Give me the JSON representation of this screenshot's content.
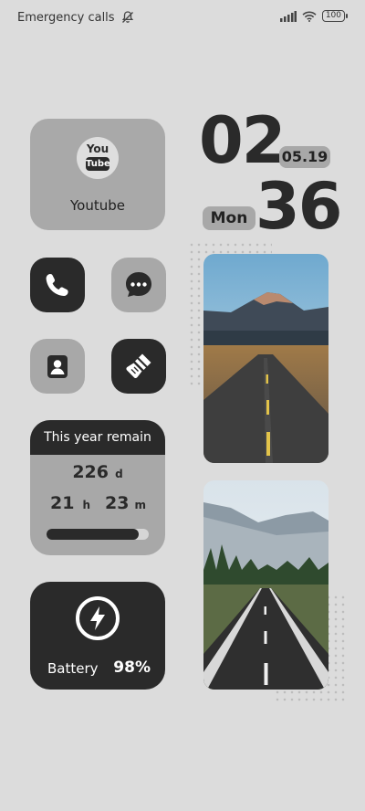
{
  "status": {
    "left_text": "Emergency calls",
    "battery": "100"
  },
  "youtube": {
    "icon_text_top": "You",
    "icon_text_bottom": "Tube",
    "label": "Youtube"
  },
  "clock": {
    "hour": "02",
    "minute": "36",
    "date": "05.19",
    "day": "Mon"
  },
  "year_remain": {
    "title": "This year remain",
    "days": "226",
    "days_unit": "d",
    "hours": "21",
    "hours_unit": "h",
    "minutes": "23",
    "minutes_unit": "m",
    "progress": 0.9
  },
  "battery_widget": {
    "label": "Battery",
    "percent": "98%"
  },
  "icons": {
    "phone": "phone-icon",
    "messages": "message-icon",
    "contacts": "contacts-icon",
    "cleaner": "broom-icon",
    "battery": "lightning-icon"
  },
  "colors": {
    "background": "#dcdcdc",
    "dark": "#2a2a2a",
    "gray": "#a8a8a8"
  }
}
